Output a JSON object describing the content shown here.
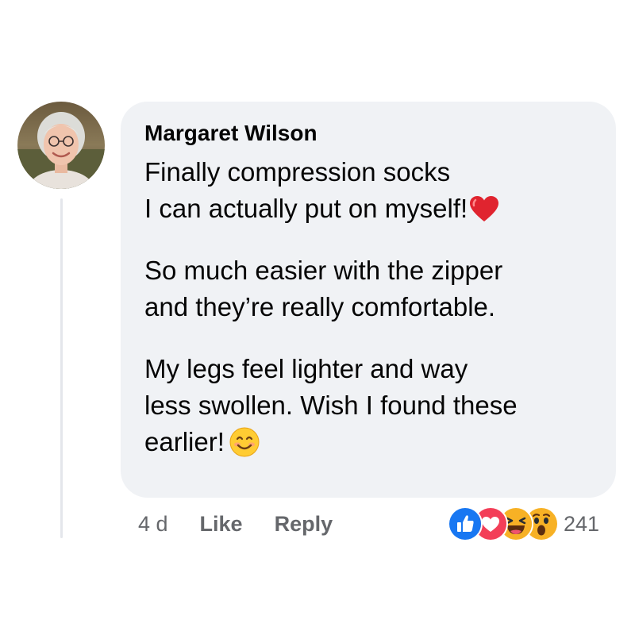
{
  "comment": {
    "author": "Margaret Wilson",
    "paragraphs": [
      {
        "lines": [
          "Finally compression socks",
          "I can actually put on myself!"
        ],
        "emoji": "red-heart"
      },
      {
        "lines": [
          "So much easier with the zipper",
          "and they’re really comfortable."
        ]
      },
      {
        "lines": [
          "My legs feel lighter and way",
          "less swollen. Wish I found these",
          "earlier!"
        ],
        "emoji": "smiling-face"
      }
    ],
    "timestamp": "4 d",
    "actions": {
      "like_label": "Like",
      "reply_label": "Reply"
    },
    "reactions": {
      "types": [
        "like-icon",
        "love-icon",
        "haha-icon",
        "wow-icon"
      ],
      "count": "241"
    }
  },
  "colors": {
    "bubble_bg": "#f0f2f5",
    "text": "#050505",
    "secondary_text": "#65676b",
    "like_blue": "#1877f2",
    "love_red": "#f33e58",
    "emoji_yellow": "#f7b125"
  }
}
